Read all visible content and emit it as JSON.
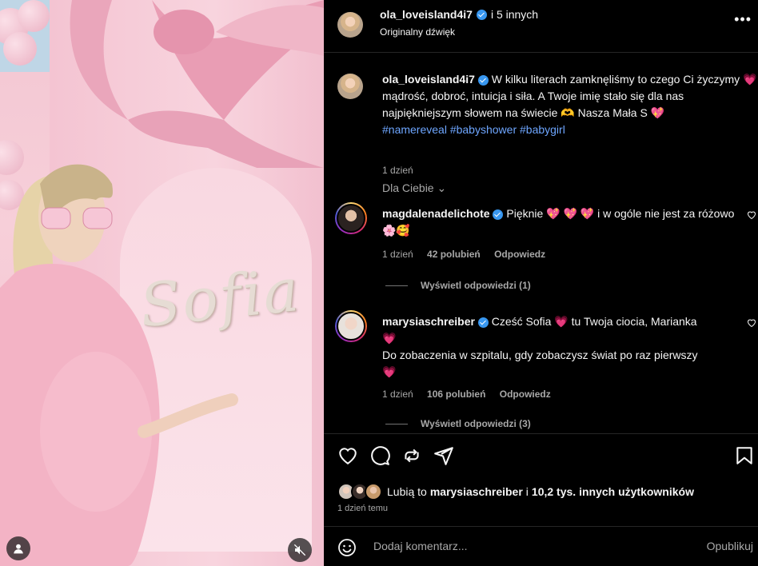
{
  "post": {
    "author": "ola_loveisland4i7",
    "coauthors": "i 5 innych",
    "audio": "Originalny dźwięk",
    "image_text": "Sofia"
  },
  "caption": {
    "username": "ola_loveisland4i7",
    "text_part1": "W kilku literach zamknęliśmy to czego Ci życzymy",
    "text_part2": "mądrość, dobroć, intuicja i siła. A Twoje imię stało się dla nas najpiękniejszym słowem na świecie",
    "text_part3": "Nasza Mała S",
    "hashtags": [
      "#namereveal",
      "#babyshower",
      "#babygirl"
    ],
    "time": "1 dzień"
  },
  "comments_filter": "Dla Ciebie",
  "comments": [
    {
      "username": "magdalenadelichote",
      "text_a": "Pięknie",
      "text_b": "i w ogóle nie jest za różowo",
      "time": "1 dzień",
      "likes": "42 polubień",
      "reply": "Odpowiedz",
      "view_replies": "Wyświetl odpowiedzi (1)"
    },
    {
      "username": "marysiaschreiber",
      "text_a": "Cześć Sofia",
      "text_b": "tu Twoja ciocia, Marianka",
      "text_c": "Do zobaczenia w szpitalu, gdy zobaczysz świat po raz pierwszy",
      "time": "1 dzień",
      "likes": "106 polubień",
      "reply": "Odpowiedz",
      "view_replies": "Wyświetl odpowiedzi (3)"
    }
  ],
  "likes": {
    "prefix": "Lubią to",
    "user": "marysiaschreiber",
    "middle": "i",
    "others": "10,2 tys. innych użytkowników"
  },
  "post_time": "1 dzień temu",
  "add_comment": {
    "placeholder": "Dodaj komentarz...",
    "post_label": "Opublikuj"
  },
  "icons": [
    "more-icon",
    "heart-icon",
    "comment-icon",
    "share-icon",
    "send-icon",
    "save-icon",
    "emoji-icon",
    "person-icon",
    "mute-icon",
    "verified-icon"
  ],
  "colors": {
    "background": "#000000",
    "text": "#f5f5f5",
    "secondary": "#a8a8a8",
    "link": "#6ea6ff",
    "verified": "#3897f0",
    "photo_pink": "#f5c7d3"
  }
}
